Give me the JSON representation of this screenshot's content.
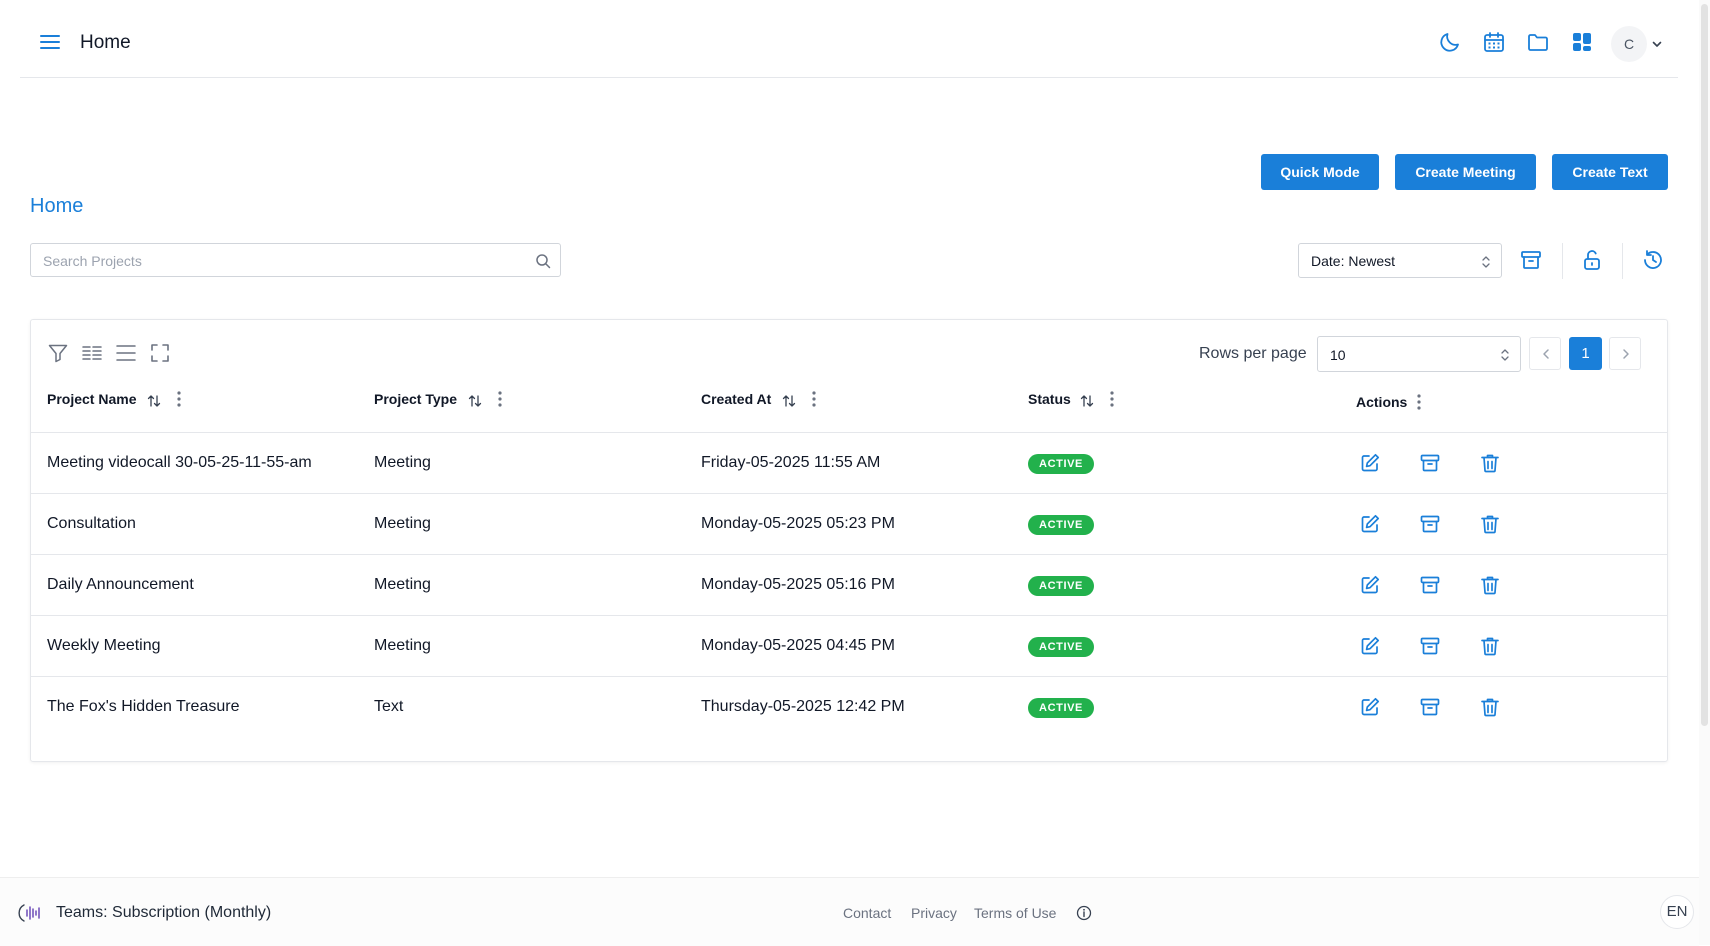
{
  "header": {
    "title": "Home",
    "icons": [
      "menu-icon",
      "moon-icon",
      "calendar-icon",
      "folder-icon",
      "dashboard-icon"
    ],
    "avatar_initial": "C"
  },
  "actions": {
    "quick_mode": "Quick Mode",
    "create_meeting": "Create Meeting",
    "create_text": "Create Text"
  },
  "page_heading": "Home",
  "search": {
    "placeholder": "Search Projects",
    "value": ""
  },
  "sort": {
    "selected": "Date: Newest"
  },
  "table": {
    "rows_per_page_label": "Rows per page",
    "rows_per_page": "10",
    "current_page": "1",
    "columns": [
      "Project Name",
      "Project Type",
      "Created At",
      "Status",
      "Actions"
    ],
    "rows": [
      {
        "name": "Meeting videocall 30-05-25-11-55-am",
        "type": "Meeting",
        "created": "Friday-05-2025 11:55 AM",
        "status": "ACTIVE"
      },
      {
        "name": "Consultation",
        "type": "Meeting",
        "created": "Monday-05-2025 05:23 PM",
        "status": "ACTIVE"
      },
      {
        "name": "Daily Announcement",
        "type": "Meeting",
        "created": "Monday-05-2025 05:16 PM",
        "status": "ACTIVE"
      },
      {
        "name": "Weekly Meeting",
        "type": "Meeting",
        "created": "Monday-05-2025 04:45 PM",
        "status": "ACTIVE"
      },
      {
        "name": "The Fox's Hidden Treasure",
        "type": "Text",
        "created": "Thursday-05-2025 12:42 PM",
        "status": "ACTIVE"
      }
    ]
  },
  "footer": {
    "team": "Teams: Subscription (Monthly)",
    "links": [
      "Contact",
      "Privacy",
      "Terms of Use"
    ],
    "language": "EN"
  },
  "colors": {
    "accent": "#1a7fd9",
    "status_active": "#22b14c",
    "border": "#e5e7eb"
  }
}
